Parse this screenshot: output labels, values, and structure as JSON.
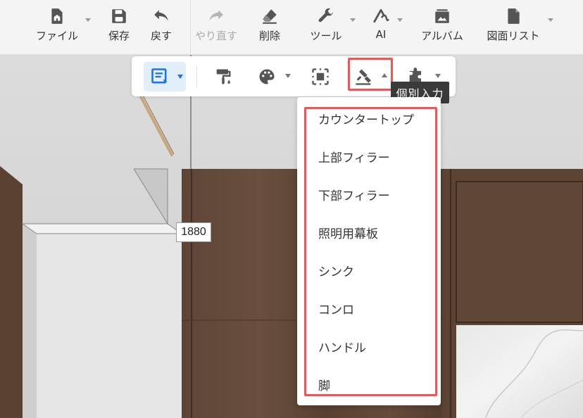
{
  "toolbar": {
    "items": [
      {
        "label": "ファイル",
        "icon": "file-icon"
      },
      {
        "label": "保存",
        "icon": "save-icon"
      },
      {
        "label": "戻す",
        "icon": "undo-icon"
      },
      {
        "label": "やり直す",
        "icon": "redo-icon",
        "disabled": true
      },
      {
        "label": "削除",
        "icon": "eraser-icon"
      },
      {
        "label": "ツール",
        "icon": "wrench-icon"
      },
      {
        "label": "AI",
        "icon": "ai-icon"
      },
      {
        "label": "アルバム",
        "icon": "album-icon"
      },
      {
        "label": "図面リスト",
        "icon": "document-icon"
      }
    ]
  },
  "subtoolbar": {
    "tools": [
      {
        "icon": "select-list-icon",
        "active": true
      },
      {
        "icon": "paint-roller-icon"
      },
      {
        "icon": "palette-icon"
      },
      {
        "icon": "frame-select-icon"
      },
      {
        "icon": "gavel-icon",
        "highlighted": true
      },
      {
        "icon": "puzzle-icon"
      }
    ],
    "tooltip": "個別入力"
  },
  "menu": {
    "items": [
      {
        "label": "カウンタートップ"
      },
      {
        "label": "上部フィラー"
      },
      {
        "label": "下部フィラー"
      },
      {
        "label": "照明用幕板"
      },
      {
        "label": "シンク"
      },
      {
        "label": "コンロ"
      },
      {
        "label": "ハンドル"
      },
      {
        "label": "脚"
      }
    ]
  },
  "scene": {
    "dimension": "1880"
  },
  "colors": {
    "accent": "#1a73e8",
    "highlight": "#ef5557",
    "icon": "#555555",
    "icon_disabled": "#b5b5b5",
    "wood": "#5b4233",
    "tooltip_bg": "#3a3a3a"
  }
}
